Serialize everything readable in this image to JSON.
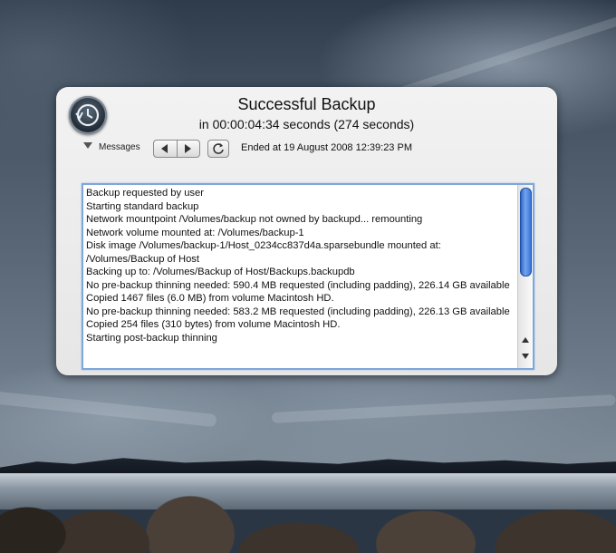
{
  "window": {
    "title": "Successful Backup",
    "subtitle": "in 00:00:04:34 seconds (274 seconds)",
    "icon": "time-machine-icon"
  },
  "toolbar": {
    "messages_label": "Messages",
    "ended_text": "Ended at 19 August 2008 12:39:23 PM",
    "prev_icon": "triangle-left-icon",
    "next_icon": "triangle-right-icon",
    "refresh_icon": "refresh-icon"
  },
  "log": {
    "lines": [
      "Backup requested by user",
      "Starting standard backup",
      "Network mountpoint /Volumes/backup not owned by backupd... remounting",
      "Network volume mounted at: /Volumes/backup-1",
      "Disk image /Volumes/backup-1/Host_0234cc837d4a.sparsebundle mounted at: /Volumes/Backup of Host",
      "Backing up to: /Volumes/Backup of Host/Backups.backupdb",
      "No pre-backup thinning needed: 590.4 MB requested (including padding), 226.14 GB available",
      "Copied 1467 files (6.0 MB) from volume Macintosh HD.",
      "No pre-backup thinning needed: 583.2 MB requested (including padding), 226.13 GB available",
      "Copied 254 files (310 bytes) from volume Macintosh HD.",
      "Starting post-backup thinning"
    ]
  },
  "colors": {
    "focus_ring": "#7fa6d8",
    "scroll_thumb": "#3a74d8"
  }
}
